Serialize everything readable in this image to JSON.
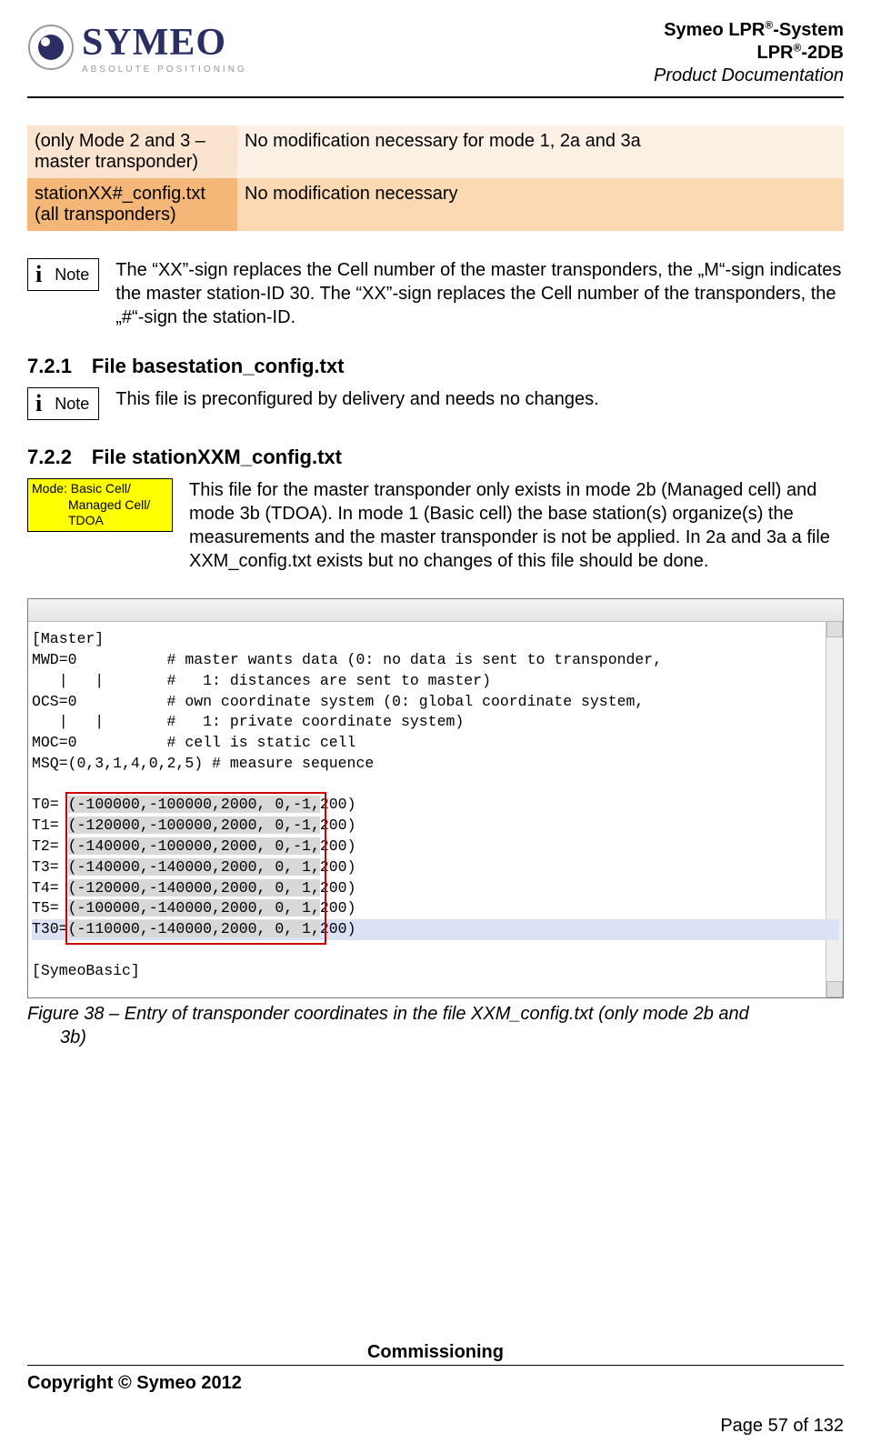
{
  "header": {
    "logo_name": "SYMEO",
    "logo_tagline": "ABSOLUTE POSITIONING",
    "title_line1_a": "Symeo LPR",
    "title_line1_b": "-System",
    "title_line2_a": "LPR",
    "title_line2_b": "-2DB",
    "title_line3": "Product Documentation",
    "sup": "®"
  },
  "table": {
    "rows": [
      {
        "key": "(only Mode 2 and 3 – master transponder)",
        "val": "No modification necessary for mode 1, 2a and 3a"
      },
      {
        "key": "stationXX#_config.txt (all transponders)",
        "val": "No modification necessary"
      }
    ]
  },
  "note1": {
    "label": "Note",
    "text": "The “XX”-sign replaces the Cell number of the master transponders, the „M“-sign indicates the master station-ID 30. The “XX”-sign replaces the Cell number of the transponders, the „#“-sign the station-ID."
  },
  "sec_721": "7.2.1 File basestation_config.txt",
  "note2": {
    "label": "Note",
    "text": "This file is preconfigured by delivery and needs no changes."
  },
  "sec_722": "7.2.2 File stationXXM_config.txt",
  "modebox": {
    "l1": "Mode: Basic Cell/",
    "l2": "Managed Cell/",
    "l3": "TDOA"
  },
  "para_722": "This file for the master transponder only exists in mode 2b (Managed cell) and mode 3b (TDOA). In mode 1 (Basic cell) the base station(s) organize(s) the measurements and the master transponder is not be applied. In 2a and 3a a file XXM_config.txt exists but no changes of this file should be done.",
  "code": {
    "l01": "[Master]",
    "l02a": "MWD=0          # master wants data (0: no data is sent to transponder,",
    "l02b": "   |   |       #   1: distances are sent to master)",
    "l03a": "OCS=0          # own coordinate system (0: global coordinate system,",
    "l03b": "   |   |       #   1: private coordinate system)",
    "l04": "MOC=0          # cell is static cell",
    "l05": "MSQ=(0,3,1,4,0,2,5) # measure sequence",
    "t_rows": [
      {
        "pre": "T0= ",
        "hl": "(-100000,-100000,2000, 0,-1,",
        "post": "200)"
      },
      {
        "pre": "T1= ",
        "hl": "(-120000,-100000,2000, 0,-1,",
        "post": "200)"
      },
      {
        "pre": "T2= ",
        "hl": "(-140000,-100000,2000, 0,-1,",
        "post": "200)"
      },
      {
        "pre": "T3= ",
        "hl": "(-140000,-140000,2000, 0, 1,",
        "post": "200)"
      },
      {
        "pre": "T4= ",
        "hl": "(-120000,-140000,2000, 0, 1,",
        "post": "200)"
      },
      {
        "pre": "T5= ",
        "hl": "(-100000,-140000,2000, 0, 1,",
        "post": "200)"
      }
    ],
    "t30": {
      "pre": "T30=",
      "mid": "(-110000,-140000,2000, 0, 1,",
      "post": "200)"
    },
    "l_end": "[SymeoBasic]"
  },
  "fig_caption_a": "Figure 38 – Entry of transponder coordinates in the file XXM_config.txt (only mode 2b and",
  "fig_caption_b": "3b)",
  "footer": {
    "section": "Commissioning",
    "copyright": "Copyright © Symeo 2012",
    "page": "Page 57 of 132"
  }
}
